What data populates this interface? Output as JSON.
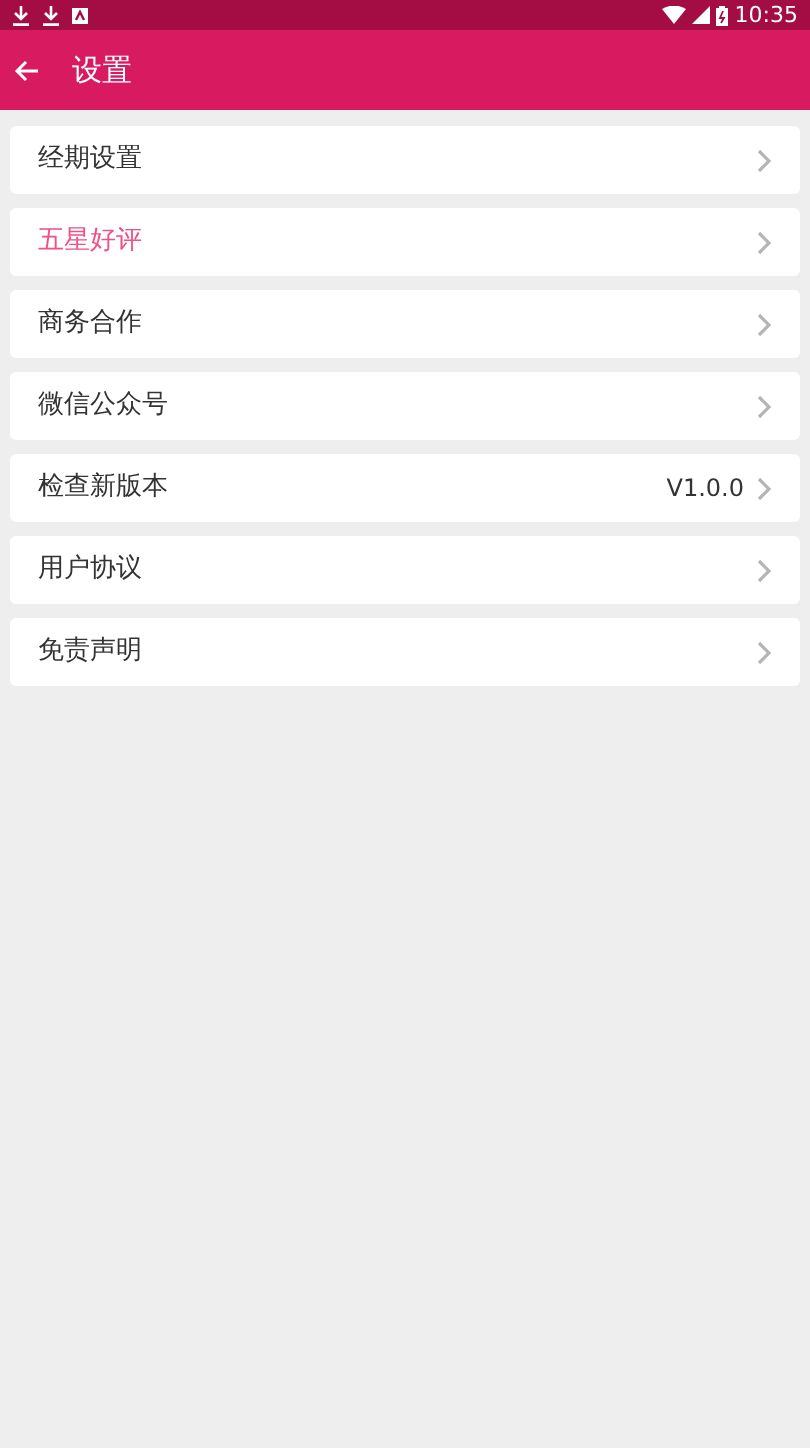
{
  "status_bar": {
    "time": "10:35"
  },
  "app_bar": {
    "title": "设置"
  },
  "items": [
    {
      "label": "经期设置",
      "color": "#333333"
    },
    {
      "label": "五星好评",
      "color": "#f0508a"
    },
    {
      "label": "商务合作",
      "color": "#333333"
    },
    {
      "label": "微信公众号",
      "color": "#333333"
    },
    {
      "label": "检查新版本",
      "color": "#333333",
      "value": "V1.0.0"
    },
    {
      "label": "用户协议",
      "color": "#333333"
    },
    {
      "label": "免责声明",
      "color": "#333333"
    }
  ]
}
